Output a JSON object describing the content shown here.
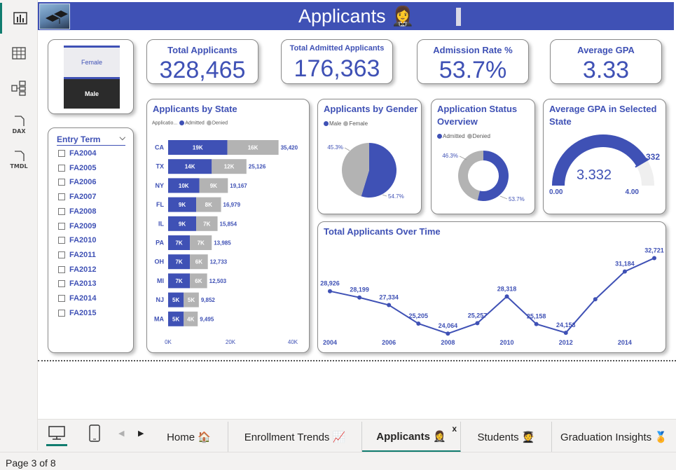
{
  "rail": {
    "items": [
      {
        "name": "report-view",
        "label": ""
      },
      {
        "name": "table-view",
        "label": ""
      },
      {
        "name": "model-view",
        "label": ""
      },
      {
        "name": "dax-query-view",
        "label": "DAX"
      },
      {
        "name": "tmdl-view",
        "label": "TMDL"
      }
    ]
  },
  "banner": {
    "title": "Applicants 🤵‍♀️",
    "color": "#3f51b5"
  },
  "gender_buttons": {
    "female": "Female",
    "male": "Male"
  },
  "kpis": {
    "total_applicants": {
      "label": "Total Applicants",
      "value": "328,465"
    },
    "total_admitted": {
      "label": "Total Admitted Applicants",
      "value": "176,363"
    },
    "admission_rate": {
      "label": "Admission Rate %",
      "value": "53.7%"
    },
    "average_gpa": {
      "label": "Average GPA",
      "value": "3.33"
    }
  },
  "slicer": {
    "title": "Entry Term",
    "items": [
      "FA2004",
      "FA2005",
      "FA2006",
      "FA2007",
      "FA2008",
      "FA2009",
      "FA2010",
      "FA2011",
      "FA2012",
      "FA2013",
      "FA2014",
      "FA2015"
    ]
  },
  "charts": {
    "by_state": {
      "title": "Applicants by State",
      "legend_prefix": "Applicatio...",
      "legend_admitted": "Admitted",
      "legend_denied": "Denied"
    },
    "by_gender": {
      "title": "Applicants by Gender",
      "legend_male": "Male",
      "legend_female": "Female"
    },
    "status": {
      "title": "Application Status Overview",
      "legend_admitted": "Admitted",
      "legend_denied": "Denied"
    },
    "gpa_state": {
      "title": "Average GPA in Selected State"
    },
    "over_time": {
      "title": "Total Applicants Over Time"
    }
  },
  "chart_data": [
    {
      "type": "bar",
      "orientation": "horizontal",
      "stacked": true,
      "title": "Applicants by State",
      "categories": [
        "CA",
        "TX",
        "NY",
        "FL",
        "IL",
        "PA",
        "OH",
        "MI",
        "NJ",
        "MA"
      ],
      "series": [
        {
          "name": "Admitted",
          "values": [
            19000,
            14000,
            10000,
            9000,
            9000,
            7000,
            7000,
            7000,
            5000,
            5000
          ],
          "labels": [
            "19K",
            "14K",
            "10K",
            "9K",
            "9K",
            "7K",
            "7K",
            "7K",
            "5K",
            "5K"
          ],
          "color": "#3f51b5"
        },
        {
          "name": "Denied",
          "values": [
            16420,
            11126,
            9167,
            7979,
            6854,
            6985,
            5733,
            5503,
            4852,
            4495
          ],
          "labels": [
            "16K",
            "12K",
            "9K",
            "8K",
            "7K",
            "7K",
            "6K",
            "6K",
            "5K",
            "4K"
          ],
          "color": "#b3b3b3"
        }
      ],
      "totals": [
        35420,
        25126,
        19167,
        16979,
        15854,
        13985,
        12733,
        12503,
        9852,
        9495
      ],
      "total_labels": [
        "35,420",
        "25,126",
        "19,167",
        "16,979",
        "15,854",
        "13,985",
        "12,733",
        "12,503",
        "9,852",
        "9,495"
      ],
      "xlim": [
        0,
        40000
      ],
      "xticks": [
        "0K",
        "20K",
        "40K"
      ]
    },
    {
      "type": "pie",
      "title": "Applicants by Gender",
      "labels": [
        "Male",
        "Female"
      ],
      "values": [
        54.7,
        45.3
      ],
      "value_labels": [
        "54.7%",
        "45.3%"
      ],
      "colors": [
        "#3f51b5",
        "#b3b3b3"
      ]
    },
    {
      "type": "pie",
      "donut": true,
      "title": "Application Status Overview",
      "labels": [
        "Admitted",
        "Denied"
      ],
      "values": [
        53.7,
        46.3
      ],
      "value_labels": [
        "53.7%",
        "46.3%"
      ],
      "colors": [
        "#3f51b5",
        "#b3b3b3"
      ]
    },
    {
      "type": "gauge",
      "title": "Average GPA in Selected State",
      "value": 3.332,
      "value_label": "3.332",
      "target_label": "3.332",
      "min": 0,
      "max": 4,
      "min_label": "0.00",
      "max_label": "4.00"
    },
    {
      "type": "line",
      "title": "Total Applicants Over Time",
      "x": [
        2004,
        2005,
        2006,
        2007,
        2008,
        2009,
        2010,
        2011,
        2012,
        2013,
        2014,
        2015
      ],
      "y": [
        28926,
        28199,
        27334,
        25205,
        24064,
        25257,
        28318,
        25158,
        24153,
        28000,
        31184,
        32721
      ],
      "point_labels": [
        "28,926",
        "28,199",
        "27,334",
        "25,205",
        "24,064",
        "25,257",
        "28,318",
        "25,158",
        "24,153",
        "",
        "31,184",
        "32,721"
      ],
      "xticks": [
        "2004",
        "2006",
        "2008",
        "2010",
        "2012",
        "2014"
      ],
      "color": "#3f51b5"
    }
  ],
  "tabs": {
    "items": [
      {
        "label": "Home 🏠"
      },
      {
        "label": "Enrollment Trends 📈"
      },
      {
        "label": "Applicants 🤵‍♀️"
      },
      {
        "label": "Students 🧑‍🎓"
      },
      {
        "label": "Graduation Insights 🏅"
      }
    ],
    "close": "x"
  },
  "status": {
    "page": "Page 3 of 8"
  }
}
